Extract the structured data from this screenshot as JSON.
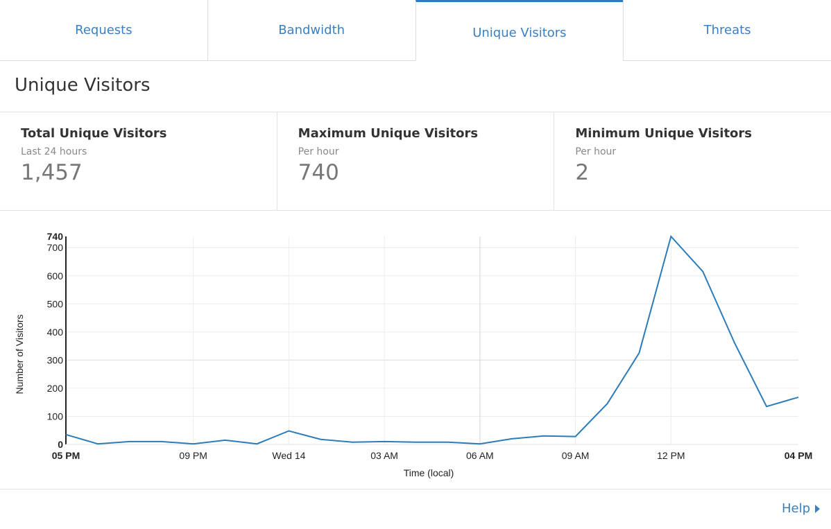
{
  "tabs": [
    {
      "label": "Requests",
      "active": false
    },
    {
      "label": "Bandwidth",
      "active": false
    },
    {
      "label": "Unique Visitors",
      "active": true
    },
    {
      "label": "Threats",
      "active": false
    }
  ],
  "page_title": "Unique Visitors",
  "stats": [
    {
      "title": "Total Unique Visitors",
      "subtitle": "Last 24 hours",
      "value": "1,457"
    },
    {
      "title": "Maximum Unique Visitors",
      "subtitle": "Per hour",
      "value": "740"
    },
    {
      "title": "Minimum Unique Visitors",
      "subtitle": "Per hour",
      "value": "2"
    }
  ],
  "help_label": "Help",
  "colors": {
    "accent": "#3a7fc1",
    "line": "#2b7bb9"
  },
  "chart_data": {
    "type": "line",
    "title": "",
    "xlabel": "Time (local)",
    "ylabel": "Number of Visitors",
    "ylim": [
      0,
      740
    ],
    "y_ticks": [
      0,
      100,
      200,
      300,
      400,
      500,
      600,
      700,
      740
    ],
    "y_bold_ticks": [
      0,
      740
    ],
    "x_ticks": [
      "05 PM",
      "09 PM",
      "Wed 14",
      "03 AM",
      "06 AM",
      "09 AM",
      "12 PM",
      "04 PM"
    ],
    "x_bold_ticks": [
      "05 PM",
      "04 PM"
    ],
    "x": [
      "05 PM",
      "06 PM",
      "07 PM",
      "08 PM",
      "09 PM",
      "10 PM",
      "11 PM",
      "Wed 14",
      "01 AM",
      "02 AM",
      "03 AM",
      "04 AM",
      "05 AM",
      "06 AM",
      "07 AM",
      "08 AM",
      "09 AM",
      "10 AM",
      "11 AM",
      "12 PM",
      "01 PM",
      "02 PM",
      "03 PM",
      "04 PM"
    ],
    "series": [
      {
        "values": [
          35,
          2,
          10,
          10,
          2,
          15,
          2,
          48,
          18,
          8,
          10,
          8,
          8,
          2,
          20,
          30,
          28,
          145,
          325,
          740,
          615,
          360,
          135,
          168
        ]
      }
    ],
    "grid": true
  }
}
